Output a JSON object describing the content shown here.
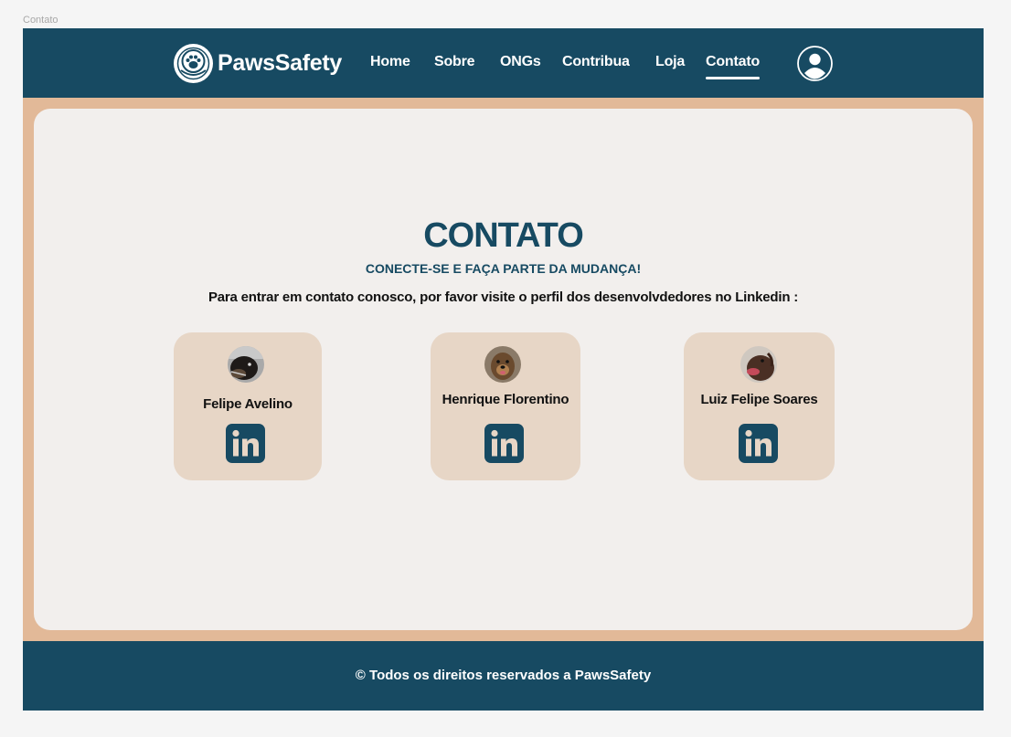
{
  "frame": {
    "label": "Contato"
  },
  "header": {
    "brand": "PawsSafety",
    "nav": [
      {
        "label": "Home"
      },
      {
        "label": "Sobre"
      },
      {
        "label": "ONGs"
      },
      {
        "label": "Contribua"
      },
      {
        "label": "Loja"
      },
      {
        "label": "Contato",
        "active": true
      }
    ],
    "icons": {
      "logo": "paw-logo-icon",
      "user": "user-profile-icon"
    }
  },
  "main": {
    "title": "CONTATO",
    "subtitle": "CONECTE-SE E FAÇA PARTE DA MUDANÇA!",
    "description": "Para entrar em contato conosco, por favor visite o perfil dos desenvolvdedores no Linkedin :",
    "developers": [
      {
        "name": "Felipe Avelino",
        "icon": "linkedin-icon"
      },
      {
        "name": "Henrique Florentino",
        "icon": "linkedin-icon"
      },
      {
        "name": "Luiz Felipe Soares",
        "icon": "linkedin-icon"
      }
    ]
  },
  "footer": {
    "text": "© Todos os direitos reservados a PawsSafety"
  },
  "colors": {
    "primary": "#174a62",
    "frame_background": "#e2b998",
    "card_background": "#f2efed",
    "developer_card": "#e7d6c6",
    "text_light": "#ffffff"
  }
}
